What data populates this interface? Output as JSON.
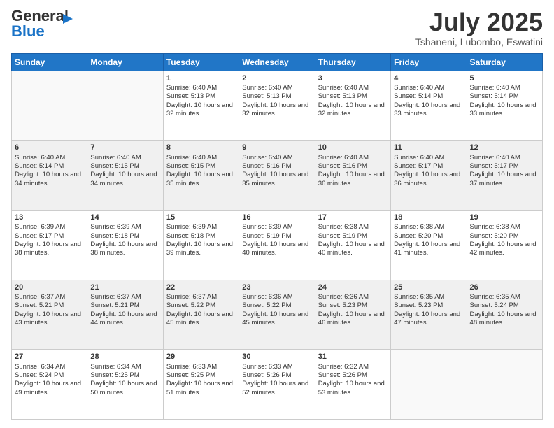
{
  "logo": {
    "line1a": "General",
    "line1b": "Blue",
    "chevron": "▶"
  },
  "header": {
    "month": "July 2025",
    "location": "Tshaneni, Lubombo, Eswatini"
  },
  "days_of_week": [
    "Sunday",
    "Monday",
    "Tuesday",
    "Wednesday",
    "Thursday",
    "Friday",
    "Saturday"
  ],
  "weeks": [
    [
      {
        "day": "",
        "info": ""
      },
      {
        "day": "",
        "info": ""
      },
      {
        "day": "1",
        "info": "Sunrise: 6:40 AM\nSunset: 5:13 PM\nDaylight: 10 hours and 32 minutes."
      },
      {
        "day": "2",
        "info": "Sunrise: 6:40 AM\nSunset: 5:13 PM\nDaylight: 10 hours and 32 minutes."
      },
      {
        "day": "3",
        "info": "Sunrise: 6:40 AM\nSunset: 5:13 PM\nDaylight: 10 hours and 32 minutes."
      },
      {
        "day": "4",
        "info": "Sunrise: 6:40 AM\nSunset: 5:14 PM\nDaylight: 10 hours and 33 minutes."
      },
      {
        "day": "5",
        "info": "Sunrise: 6:40 AM\nSunset: 5:14 PM\nDaylight: 10 hours and 33 minutes."
      }
    ],
    [
      {
        "day": "6",
        "info": "Sunrise: 6:40 AM\nSunset: 5:14 PM\nDaylight: 10 hours and 34 minutes."
      },
      {
        "day": "7",
        "info": "Sunrise: 6:40 AM\nSunset: 5:15 PM\nDaylight: 10 hours and 34 minutes."
      },
      {
        "day": "8",
        "info": "Sunrise: 6:40 AM\nSunset: 5:15 PM\nDaylight: 10 hours and 35 minutes."
      },
      {
        "day": "9",
        "info": "Sunrise: 6:40 AM\nSunset: 5:16 PM\nDaylight: 10 hours and 35 minutes."
      },
      {
        "day": "10",
        "info": "Sunrise: 6:40 AM\nSunset: 5:16 PM\nDaylight: 10 hours and 36 minutes."
      },
      {
        "day": "11",
        "info": "Sunrise: 6:40 AM\nSunset: 5:17 PM\nDaylight: 10 hours and 36 minutes."
      },
      {
        "day": "12",
        "info": "Sunrise: 6:40 AM\nSunset: 5:17 PM\nDaylight: 10 hours and 37 minutes."
      }
    ],
    [
      {
        "day": "13",
        "info": "Sunrise: 6:39 AM\nSunset: 5:17 PM\nDaylight: 10 hours and 38 minutes."
      },
      {
        "day": "14",
        "info": "Sunrise: 6:39 AM\nSunset: 5:18 PM\nDaylight: 10 hours and 38 minutes."
      },
      {
        "day": "15",
        "info": "Sunrise: 6:39 AM\nSunset: 5:18 PM\nDaylight: 10 hours and 39 minutes."
      },
      {
        "day": "16",
        "info": "Sunrise: 6:39 AM\nSunset: 5:19 PM\nDaylight: 10 hours and 40 minutes."
      },
      {
        "day": "17",
        "info": "Sunrise: 6:38 AM\nSunset: 5:19 PM\nDaylight: 10 hours and 40 minutes."
      },
      {
        "day": "18",
        "info": "Sunrise: 6:38 AM\nSunset: 5:20 PM\nDaylight: 10 hours and 41 minutes."
      },
      {
        "day": "19",
        "info": "Sunrise: 6:38 AM\nSunset: 5:20 PM\nDaylight: 10 hours and 42 minutes."
      }
    ],
    [
      {
        "day": "20",
        "info": "Sunrise: 6:37 AM\nSunset: 5:21 PM\nDaylight: 10 hours and 43 minutes."
      },
      {
        "day": "21",
        "info": "Sunrise: 6:37 AM\nSunset: 5:21 PM\nDaylight: 10 hours and 44 minutes."
      },
      {
        "day": "22",
        "info": "Sunrise: 6:37 AM\nSunset: 5:22 PM\nDaylight: 10 hours and 45 minutes."
      },
      {
        "day": "23",
        "info": "Sunrise: 6:36 AM\nSunset: 5:22 PM\nDaylight: 10 hours and 45 minutes."
      },
      {
        "day": "24",
        "info": "Sunrise: 6:36 AM\nSunset: 5:23 PM\nDaylight: 10 hours and 46 minutes."
      },
      {
        "day": "25",
        "info": "Sunrise: 6:35 AM\nSunset: 5:23 PM\nDaylight: 10 hours and 47 minutes."
      },
      {
        "day": "26",
        "info": "Sunrise: 6:35 AM\nSunset: 5:24 PM\nDaylight: 10 hours and 48 minutes."
      }
    ],
    [
      {
        "day": "27",
        "info": "Sunrise: 6:34 AM\nSunset: 5:24 PM\nDaylight: 10 hours and 49 minutes."
      },
      {
        "day": "28",
        "info": "Sunrise: 6:34 AM\nSunset: 5:25 PM\nDaylight: 10 hours and 50 minutes."
      },
      {
        "day": "29",
        "info": "Sunrise: 6:33 AM\nSunset: 5:25 PM\nDaylight: 10 hours and 51 minutes."
      },
      {
        "day": "30",
        "info": "Sunrise: 6:33 AM\nSunset: 5:26 PM\nDaylight: 10 hours and 52 minutes."
      },
      {
        "day": "31",
        "info": "Sunrise: 6:32 AM\nSunset: 5:26 PM\nDaylight: 10 hours and 53 minutes."
      },
      {
        "day": "",
        "info": ""
      },
      {
        "day": "",
        "info": ""
      }
    ]
  ]
}
